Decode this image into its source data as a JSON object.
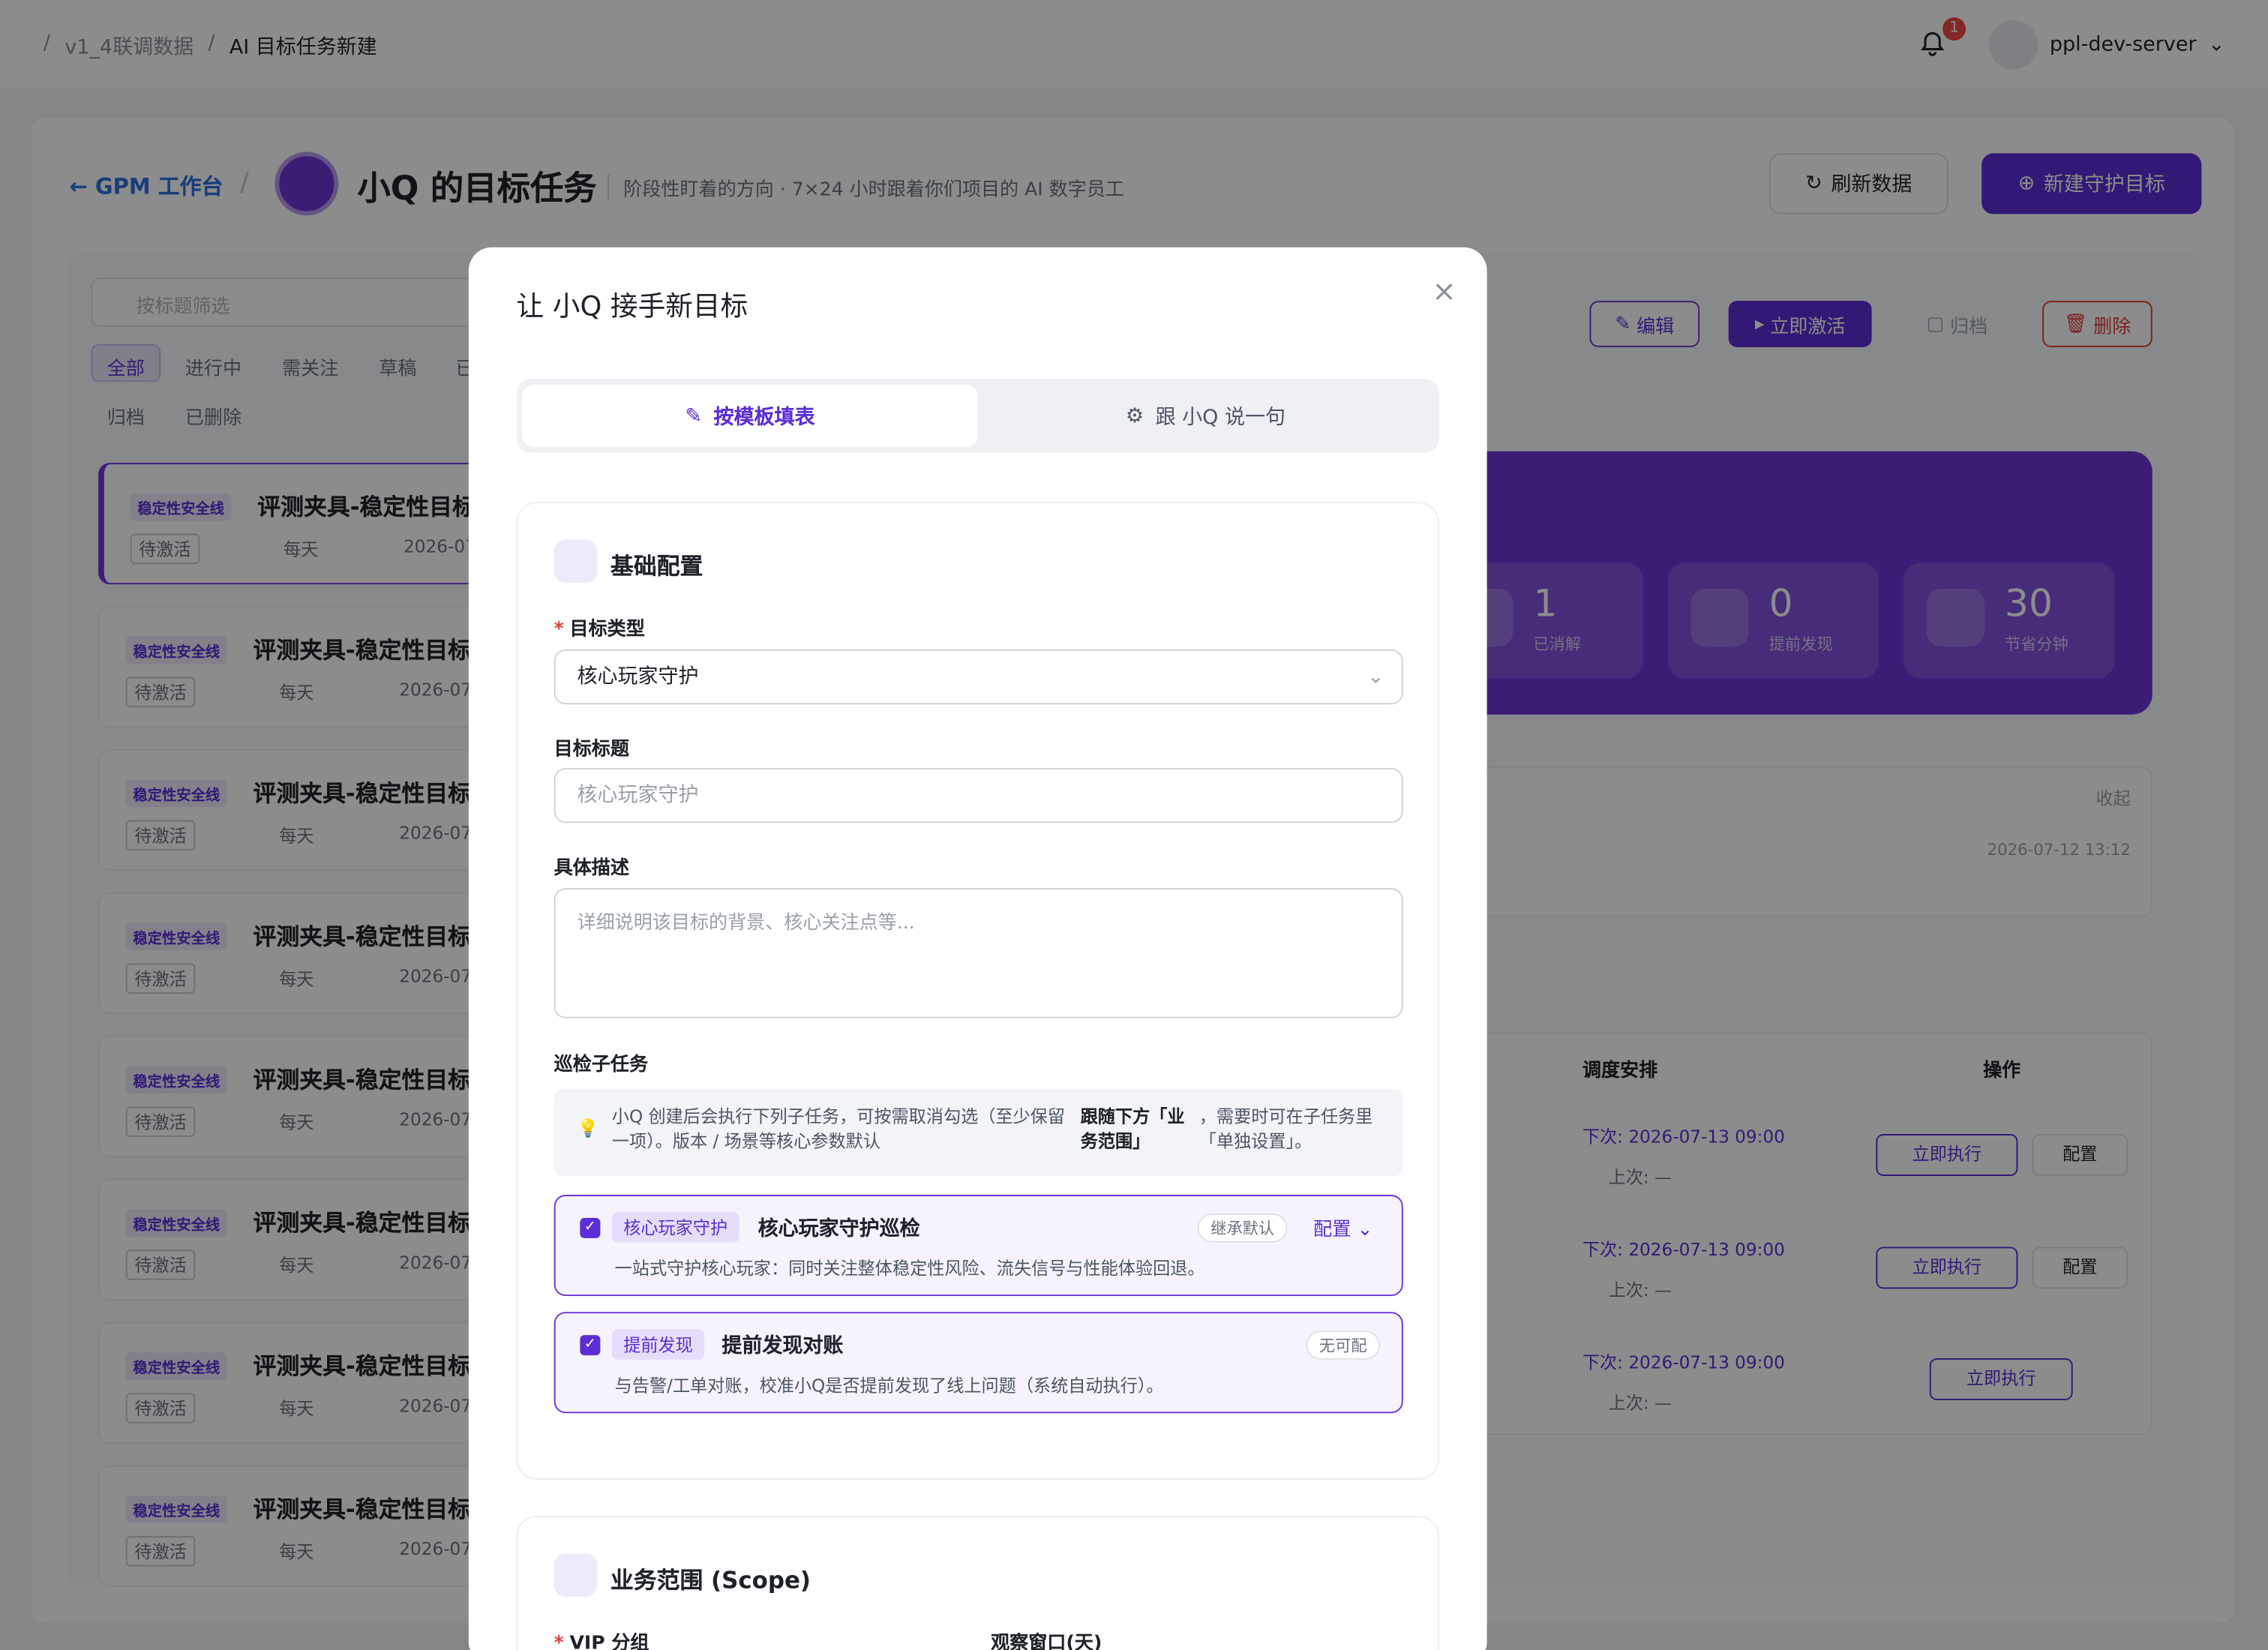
{
  "breadcrumb": {
    "items": [
      "v1_4联调数据",
      "AI 目标任务新建"
    ]
  },
  "header": {
    "notification_count": "1",
    "username": "ppl-dev-server"
  },
  "page": {
    "back_label": "GPM 工作台",
    "title": "小Q 的目标任务",
    "subtitle": "阶段性盯着的方向 · 7×24 小时跟着你们项目的 AI 数字员工",
    "refresh_label": "刷新数据",
    "new_label": "新建守护目标"
  },
  "filters": {
    "search_placeholder": "按标题筛选",
    "chips": [
      "全部",
      "进行中",
      "需关注",
      "草稿",
      "已",
      "归档",
      "已删除"
    ]
  },
  "list": {
    "tag": "稳定性安全线",
    "title": "评测夹具-稳定性目标",
    "status": "待激活",
    "freq": "每天",
    "date": "2026-07"
  },
  "detail": {
    "edit": "编辑",
    "activate": "立即激活",
    "archive": "归档",
    "delete": "删除",
    "stats": [
      {
        "num": "1",
        "label": "已消解"
      },
      {
        "num": "0",
        "label": "提前发现"
      },
      {
        "num": "30",
        "label": "节省分钟"
      }
    ],
    "collapse": "收起",
    "time": "2026-07-12 13:12"
  },
  "table": {
    "col_schedule": "调度安排",
    "col_ops": "操作",
    "next": "下次: 2026-07-13 09:00",
    "last": "上次: —",
    "run": "立即执行",
    "config": "配置"
  },
  "colors": {
    "accent": "#5b2ed6",
    "accent_light": "#efe9fc",
    "danger": "#e23d3d",
    "link": "#2f6fe0"
  },
  "modal": {
    "title": "让 小Q 接手新目标",
    "tab_template": "按模板填表",
    "tab_chat": "跟 小Q 说一句",
    "basic": {
      "title": "基础配置",
      "type_label": "目标类型",
      "type_value": "核心玩家守护",
      "title_label": "目标标题",
      "title_placeholder": "核心玩家守护",
      "desc_label": "具体描述",
      "desc_placeholder": "详细说明该目标的背景、核心关注点等...",
      "subtask_label": "巡检子任务",
      "hint_a": "小Q 创建后会执行下列子任务，可按需取消勾选（至少保留一项）。版本 / 场景等核心参数默认",
      "hint_b": "跟随下方「业务范围」",
      "hint_c": "，需要时可在子任务里「单独设置」。"
    },
    "tasks": [
      {
        "tag": "核心玩家守护",
        "name": "核心玩家守护巡检",
        "desc": "一站式守护核心玩家：同时关注整体稳定性风险、流失信号与性能体验回退。",
        "pill": "继承默认",
        "action": "配置"
      },
      {
        "tag": "提前发现",
        "name": "提前发现对账",
        "desc": "与告警/工单对账，校准小Q是否提前发现了线上问题（系统自动执行）。",
        "pill": "无可配",
        "action": ""
      }
    ],
    "scope": {
      "title": "业务范围 (Scope)",
      "vip_label": "VIP 分组",
      "window_label": "观察窗口(天)"
    }
  }
}
